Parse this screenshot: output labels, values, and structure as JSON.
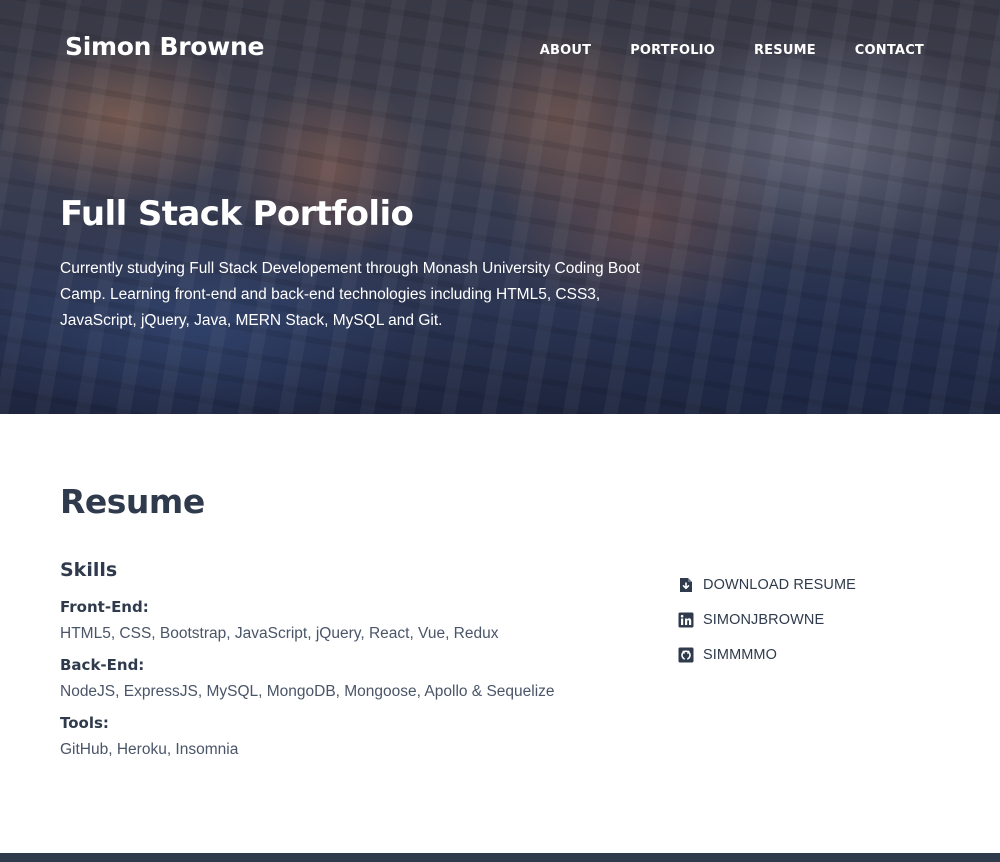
{
  "header": {
    "brand": "Simon Browne",
    "nav": [
      {
        "label": "ABOUT"
      },
      {
        "label": "PORTFOLIO"
      },
      {
        "label": "RESUME"
      },
      {
        "label": "CONTACT"
      }
    ]
  },
  "hero": {
    "title": "Full Stack Portfolio",
    "description": "Currently studying Full Stack Developement through Monash University Coding Boot Camp. Learning front-end and back-end technologies including HTML5, CSS3, JavaScript, jQuery, Java, MERN Stack, MySQL and Git."
  },
  "resume": {
    "heading": "Resume",
    "skills_heading": "Skills",
    "skills": [
      {
        "category": "Front-End:",
        "items": "HTML5, CSS, Bootstrap, JavaScript, jQuery, React, Vue, Redux"
      },
      {
        "category": "Back-End:",
        "items": "NodeJS, ExpressJS, MySQL, MongoDB, Mongoose, Apollo & Sequelize"
      },
      {
        "category": "Tools:",
        "items": "GitHub, Heroku, Insomnia"
      }
    ],
    "links": [
      {
        "icon": "file-download-icon",
        "label": "DOWNLOAD RESUME"
      },
      {
        "icon": "linkedin-icon",
        "label": "SIMONJBROWNE"
      },
      {
        "icon": "github-icon",
        "label": "SIMMMMO"
      }
    ]
  },
  "colors": {
    "text_dark": "#2f3b4c",
    "text_muted": "#4a5568",
    "footer": "#2f3b4c"
  }
}
